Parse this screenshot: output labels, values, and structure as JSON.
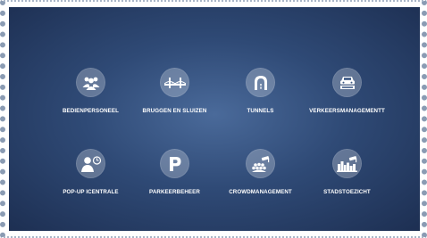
{
  "tiles": [
    {
      "label": "BEDIENPERSONEEL",
      "icon": "people-group-icon"
    },
    {
      "label": "BRUGGEN EN SLUIZEN",
      "icon": "bridge-icon"
    },
    {
      "label": "TUNNELS",
      "icon": "tunnel-icon"
    },
    {
      "label": "VERKEERSMANAGEMENTT",
      "icon": "traffic-cars-icon"
    },
    {
      "label": "POP-UP ICENTRALE",
      "icon": "operator-clock-icon"
    },
    {
      "label": "PARKEERBEHEER",
      "icon": "parking-icon"
    },
    {
      "label": "CROWDMANAGEMENT",
      "icon": "crowd-camera-icon"
    },
    {
      "label": "STADSTOEZICHT",
      "icon": "city-camera-icon"
    }
  ],
  "colors": {
    "panel_center": "#4a6a9a",
    "panel_edge": "#1d2f52",
    "icon_circle": "rgba(255,255,255,0.26)",
    "text": "#ffffff"
  }
}
